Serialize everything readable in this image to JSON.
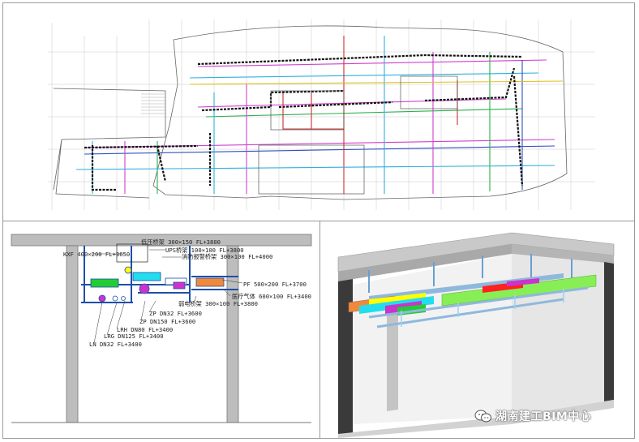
{
  "section": {
    "labels": [
      "KXF 400×200 FL+3650",
      "低压桥架 300×150 FL+3800",
      "UPS桥架 100×100 FL+3800",
      "消防报警桥架 300×100 FL+4000",
      "PF 500×200 FL+3700",
      "医疗气体 600×100 FL+3400",
      "弱电桥架 300×100 FL+3800",
      "ZP DN32 FL+3600",
      "ZP DN150 FL+3600",
      "LRH DN80 FL+3400",
      "LRG DN125 FL+3400",
      "LN DN32 FL+3400"
    ]
  },
  "watermark": {
    "text": "湖南建工BIM中心",
    "icon": "wechat-icon"
  },
  "colors": {
    "frame": "#9a9a9a",
    "pipe_blue": "#1f4ea8",
    "green": "#22cc33",
    "yellow": "#ffff00",
    "magenta": "#cc33cc",
    "cyan": "#22ddee",
    "orange": "#f08a3a",
    "slab_gray": "#b8b8b8"
  }
}
